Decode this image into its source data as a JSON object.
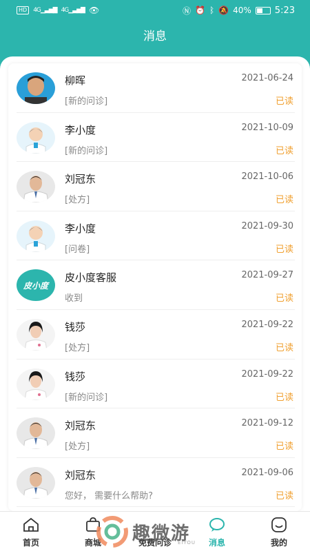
{
  "status_bar": {
    "hd": "HD",
    "signal1": "4G",
    "signal2": "4G",
    "battery": "40%",
    "time": "5:23"
  },
  "header": {
    "title": "消息"
  },
  "messages": [
    {
      "name": "柳晖",
      "date": "2021-06-24",
      "preview": "[新的问诊]",
      "status": "已读",
      "avatar": "photo-man"
    },
    {
      "name": "李小度",
      "date": "2021-10-09",
      "preview": "[新的问诊]",
      "status": "已读",
      "avatar": "cartoon-doctor"
    },
    {
      "name": "刘冠东",
      "date": "2021-10-06",
      "preview": "[处方]",
      "status": "已读",
      "avatar": "doctor-male"
    },
    {
      "name": "李小度",
      "date": "2021-09-30",
      "preview": "[问卷]",
      "status": "已读",
      "avatar": "cartoon-doctor"
    },
    {
      "name": "皮小度客服",
      "date": "2021-09-27",
      "preview": "收到",
      "status": "已读",
      "avatar": "logo-pixiaodu",
      "avatar_text": "皮小度"
    },
    {
      "name": "钱莎",
      "date": "2021-09-22",
      "preview": "[处方]",
      "status": "已读",
      "avatar": "doctor-female"
    },
    {
      "name": "钱莎",
      "date": "2021-09-22",
      "preview": "[新的问诊]",
      "status": "已读",
      "avatar": "doctor-female"
    },
    {
      "name": "刘冠东",
      "date": "2021-09-12",
      "preview": "[处方]",
      "status": "已读",
      "avatar": "doctor-male"
    },
    {
      "name": "刘冠东",
      "date": "2021-09-06",
      "preview": "您好， 需要什么帮助?",
      "status": "已读",
      "avatar": "doctor-male"
    }
  ],
  "tabbar": {
    "home": "首页",
    "mall": "商城",
    "consult": "免费问诊",
    "messages": "消息",
    "mine": "我的"
  },
  "watermark": {
    "text": "趣微游",
    "sub": "EIYOU"
  },
  "colors": {
    "accent": "#2cb5ad",
    "read": "#f0a030"
  }
}
